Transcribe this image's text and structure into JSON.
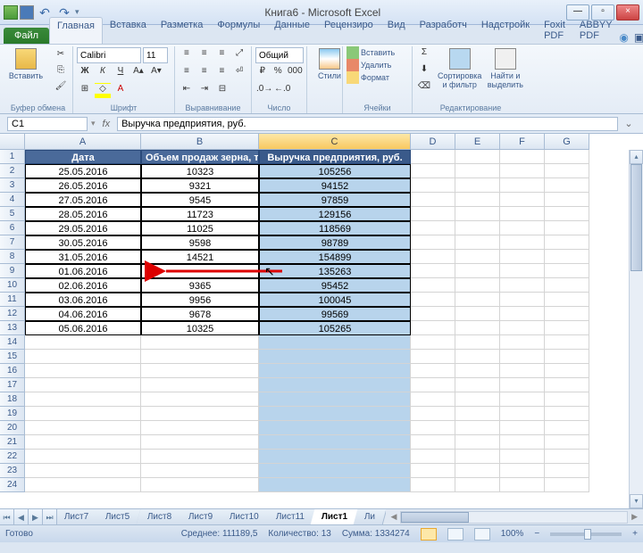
{
  "window": {
    "title": "Книга6 - Microsoft Excel",
    "min": "—",
    "max": "▫",
    "close": "×"
  },
  "ribbon": {
    "file": "Файл",
    "tabs": [
      "Главная",
      "Вставка",
      "Разметка",
      "Формулы",
      "Данные",
      "Рецензиро",
      "Вид",
      "Разработч",
      "Надстройк",
      "Foxit PDF",
      "ABBYY PDF"
    ],
    "active_tab_index": 0,
    "help_icons": [
      "?",
      "▣",
      "—",
      "▫",
      "×"
    ],
    "groups": {
      "clipboard": {
        "label": "Буфер обмена",
        "paste": "Вставить"
      },
      "font": {
        "label": "Шрифт",
        "name": "Calibri",
        "size": "11"
      },
      "alignment": {
        "label": "Выравнивание"
      },
      "number": {
        "label": "Число",
        "format": "Общий"
      },
      "styles": {
        "label": "",
        "btn": "Стили"
      },
      "cells": {
        "label": "Ячейки",
        "insert": "Вставить",
        "delete": "Удалить",
        "format": "Формат"
      },
      "editing": {
        "label": "Редактирование",
        "sort": "Сортировка и фильтр",
        "find": "Найти и выделить"
      }
    }
  },
  "formula_bar": {
    "name_box": "C1",
    "formula": "Выручка предприятия, руб.",
    "fx": "fx"
  },
  "grid": {
    "columns": [
      {
        "letter": "A",
        "width": 130
      },
      {
        "letter": "B",
        "width": 132
      },
      {
        "letter": "C",
        "width": 170
      },
      {
        "letter": "D",
        "width": 50
      },
      {
        "letter": "E",
        "width": 50
      },
      {
        "letter": "F",
        "width": 50
      },
      {
        "letter": "G",
        "width": 50
      }
    ],
    "selected_col_index": 2,
    "headers": [
      "Дата",
      "Объем продаж зерна, т",
      "Выручка предприятия, руб."
    ],
    "rows": [
      [
        "25.05.2016",
        "10323",
        "105256"
      ],
      [
        "26.05.2016",
        "9321",
        "94152"
      ],
      [
        "27.05.2016",
        "9545",
        "97859"
      ],
      [
        "28.05.2016",
        "11723",
        "129156"
      ],
      [
        "29.05.2016",
        "11025",
        "118569"
      ],
      [
        "30.05.2016",
        "9598",
        "98789"
      ],
      [
        "31.05.2016",
        "14521",
        "154899"
      ],
      [
        "01.06.2016",
        "",
        "135263"
      ],
      [
        "02.06.2016",
        "9365",
        "95452"
      ],
      [
        "03.06.2016",
        "9956",
        "100045"
      ],
      [
        "04.06.2016",
        "9678",
        "99569"
      ],
      [
        "05.06.2016",
        "10325",
        "105265"
      ]
    ],
    "visible_row_count": 24
  },
  "sheet_tabs": {
    "tabs": [
      "Лист7",
      "Лист5",
      "Лист8",
      "Лист9",
      "Лист10",
      "Лист11",
      "Лист1",
      "Ли"
    ],
    "active_index": 6
  },
  "status_bar": {
    "ready": "Готово",
    "average_label": "Среднее:",
    "average": "111189,5",
    "count_label": "Количество:",
    "count": "13",
    "sum_label": "Сумма:",
    "sum": "1334274",
    "zoom": "100%"
  },
  "annotation": {
    "arrow_row": 9
  }
}
